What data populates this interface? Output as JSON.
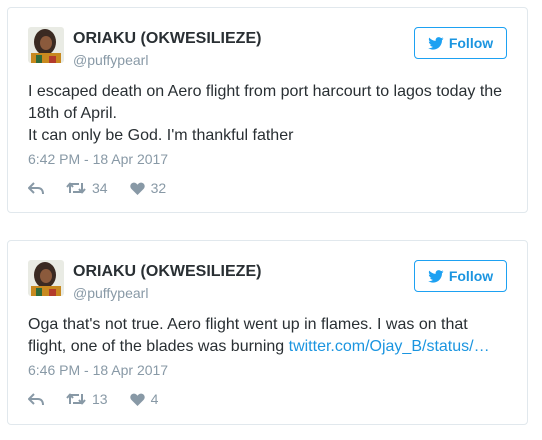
{
  "tweets": [
    {
      "name": "ORIAKU (OKWESILIEZE)",
      "handle": "@puffypearl",
      "follow_label": "Follow",
      "text_lines": [
        "I escaped death on Aero flight from port harcourt to lagos today the 18th of April.",
        "It can only be God. I'm thankful father"
      ],
      "timestamp": "6:42 PM - 18 Apr 2017",
      "retweets": "34",
      "likes": "32"
    },
    {
      "name": "ORIAKU (OKWESILIEZE)",
      "handle": "@puffypearl",
      "follow_label": "Follow",
      "text": "Oga that's not true. Aero flight went up in flames. I was on that flight, one of the blades was burning",
      "link": "twitter.com/Ojay_B/status/…",
      "timestamp": "6:46 PM - 18 Apr 2017",
      "retweets": "13",
      "likes": "4"
    }
  ],
  "colors": {
    "brand_blue": "#1da1f2",
    "link_blue": "#1b95e0",
    "muted": "#8899a6",
    "text": "#292f33",
    "border": "#e1e8ed"
  }
}
